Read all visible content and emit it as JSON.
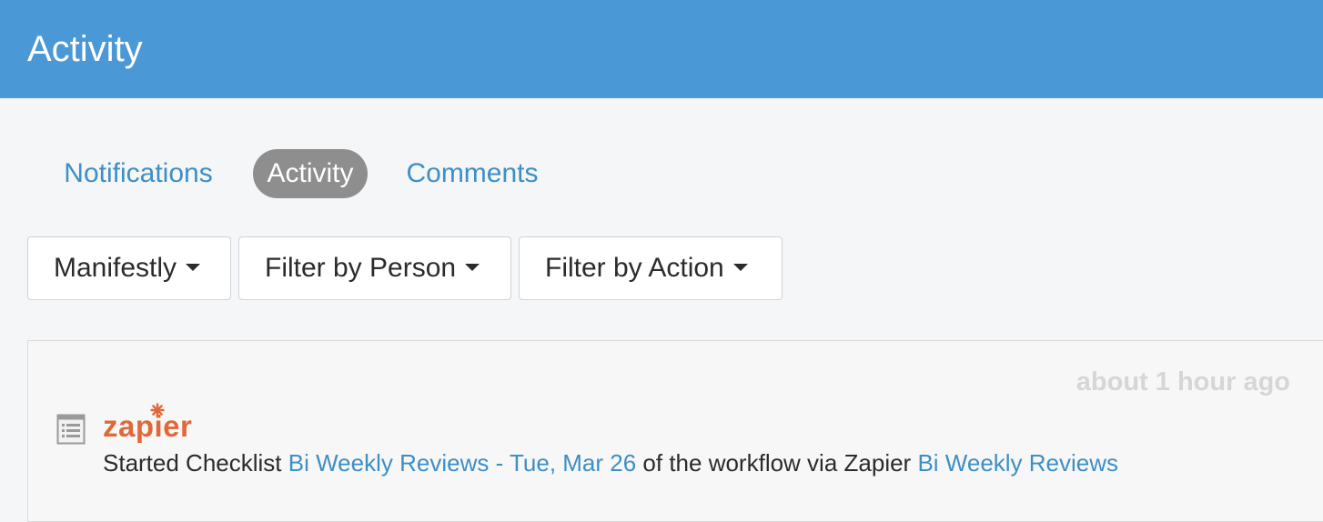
{
  "header": {
    "title": "Activity"
  },
  "tabs": [
    {
      "label": "Notifications",
      "active": false
    },
    {
      "label": "Activity",
      "active": true
    },
    {
      "label": "Comments",
      "active": false
    }
  ],
  "filters": {
    "organization": "Manifestly",
    "person": "Filter by Person",
    "action": "Filter by Action"
  },
  "feed": {
    "entries": [
      {
        "timestamp": "about 1 hour ago",
        "icon": "checklist-icon",
        "actor_logo": "zapier",
        "text_prefix": "Started Checklist",
        "checklist_link": "Bi Weekly Reviews - Tue, Mar 26",
        "text_middle": "of the workflow via Zapier",
        "workflow_link": "Bi Weekly Reviews"
      }
    ]
  },
  "colors": {
    "header_bg": "#4a98d5",
    "link": "#3d8fc6",
    "active_tab_bg": "#8e8e8e",
    "zapier_orange": "#e0693a"
  }
}
